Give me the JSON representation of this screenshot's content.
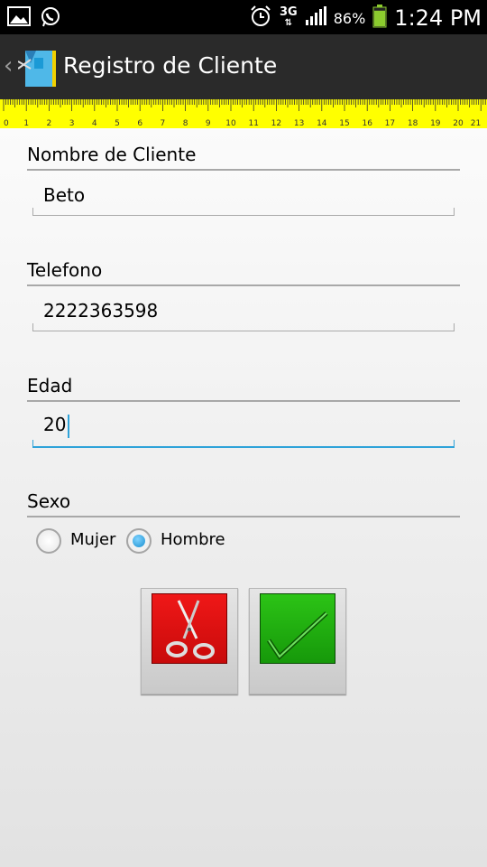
{
  "status_bar": {
    "network": "3G",
    "battery_percent": "86%",
    "battery_level": 0.86,
    "time": "1:24 PM",
    "icons": [
      "gallery-icon",
      "whatsapp-icon",
      "alarm-icon",
      "network-3g-icon",
      "signal-icon",
      "battery-icon"
    ]
  },
  "action_bar": {
    "title": "Registro de Cliente",
    "icons": [
      "back-chevron-icon",
      "app-logo-icon"
    ]
  },
  "ruler": {
    "labels": [
      "0",
      "1",
      "2",
      "3",
      "4",
      "5",
      "6",
      "7",
      "8",
      "9",
      "10",
      "11",
      "12",
      "13",
      "14",
      "15",
      "16",
      "17",
      "18",
      "19",
      "20",
      "21"
    ],
    "color": "#ffff00"
  },
  "form": {
    "nombre": {
      "label": "Nombre de Cliente",
      "value": "Beto"
    },
    "telefono": {
      "label": "Telefono",
      "value": "2222363598"
    },
    "edad": {
      "label": "Edad",
      "value": "20"
    },
    "sexo": {
      "label": "Sexo",
      "options": [
        {
          "label": "Mujer",
          "checked": false
        },
        {
          "label": "Hombre",
          "checked": true
        }
      ]
    }
  },
  "buttons": [
    {
      "name": "cancel-button",
      "icon": "scissors-icon",
      "color": "#e01010"
    },
    {
      "name": "confirm-button",
      "icon": "checkmark-icon",
      "color": "#22b010"
    }
  ],
  "colors": {
    "accent": "#2fa3d9",
    "action_bar": "#2a2a2a"
  }
}
